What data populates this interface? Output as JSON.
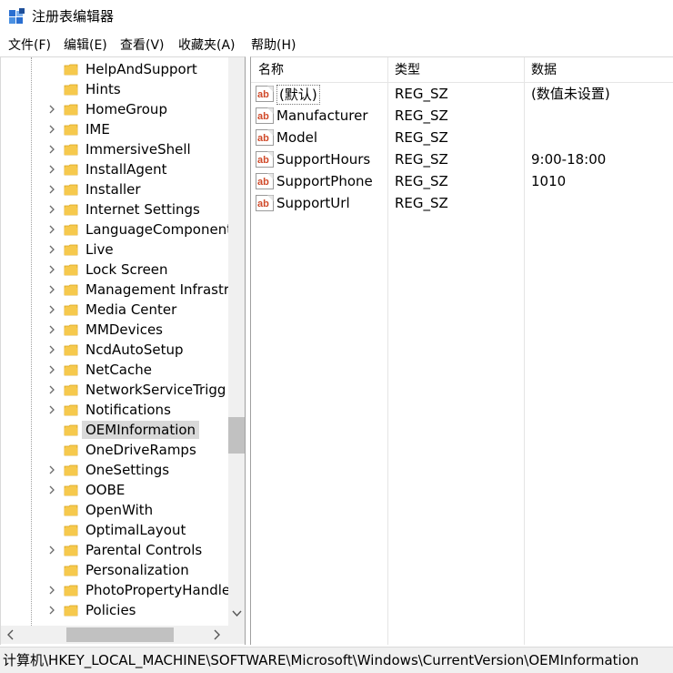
{
  "window": {
    "title": "注册表编辑器",
    "icon": "regedit-icon"
  },
  "menu": [
    "文件(F)",
    "编辑(E)",
    "查看(V)",
    "收藏夹(A)",
    "帮助(H)"
  ],
  "tree": {
    "items": [
      {
        "label": "HelpAndSupport",
        "expandable": false,
        "selected": false
      },
      {
        "label": "Hints",
        "expandable": false,
        "selected": false
      },
      {
        "label": "HomeGroup",
        "expandable": true,
        "selected": false
      },
      {
        "label": "IME",
        "expandable": true,
        "selected": false
      },
      {
        "label": "ImmersiveShell",
        "expandable": true,
        "selected": false
      },
      {
        "label": "InstallAgent",
        "expandable": true,
        "selected": false
      },
      {
        "label": "Installer",
        "expandable": true,
        "selected": false
      },
      {
        "label": "Internet Settings",
        "expandable": true,
        "selected": false
      },
      {
        "label": "LanguageComponent",
        "expandable": true,
        "selected": false
      },
      {
        "label": "Live",
        "expandable": true,
        "selected": false
      },
      {
        "label": "Lock Screen",
        "expandable": true,
        "selected": false
      },
      {
        "label": "Management Infrastru",
        "expandable": true,
        "selected": false
      },
      {
        "label": "Media Center",
        "expandable": true,
        "selected": false
      },
      {
        "label": "MMDevices",
        "expandable": true,
        "selected": false
      },
      {
        "label": "NcdAutoSetup",
        "expandable": true,
        "selected": false
      },
      {
        "label": "NetCache",
        "expandable": true,
        "selected": false
      },
      {
        "label": "NetworkServiceTrigg",
        "expandable": true,
        "selected": false
      },
      {
        "label": "Notifications",
        "expandable": true,
        "selected": false
      },
      {
        "label": "OEMInformation",
        "expandable": false,
        "selected": true
      },
      {
        "label": "OneDriveRamps",
        "expandable": false,
        "selected": false
      },
      {
        "label": "OneSettings",
        "expandable": true,
        "selected": false
      },
      {
        "label": "OOBE",
        "expandable": true,
        "selected": false
      },
      {
        "label": "OpenWith",
        "expandable": false,
        "selected": false
      },
      {
        "label": "OptimalLayout",
        "expandable": false,
        "selected": false
      },
      {
        "label": "Parental Controls",
        "expandable": true,
        "selected": false
      },
      {
        "label": "Personalization",
        "expandable": false,
        "selected": false
      },
      {
        "label": "PhotoPropertyHandle",
        "expandable": true,
        "selected": false
      },
      {
        "label": "Policies",
        "expandable": true,
        "selected": false
      }
    ],
    "scroll_position": 0.7
  },
  "list": {
    "headers": {
      "name": "名称",
      "type": "类型",
      "data": "数据"
    },
    "rows": [
      {
        "name": "(默认)",
        "type": "REG_SZ",
        "data": "(数值未设置)"
      },
      {
        "name": "Manufacturer",
        "type": "REG_SZ",
        "data": ""
      },
      {
        "name": "Model",
        "type": "REG_SZ",
        "data": ""
      },
      {
        "name": "SupportHours",
        "type": "REG_SZ",
        "data": "9:00-18:00"
      },
      {
        "name": "SupportPhone",
        "type": "REG_SZ",
        "data": "1010"
      },
      {
        "name": "SupportUrl",
        "type": "REG_SZ",
        "data": ""
      }
    ],
    "row_icon": "reg-string-ab-icon"
  },
  "status": {
    "path": "计算机\\HKEY_LOCAL_MACHINE\\SOFTWARE\\Microsoft\\Windows\\CurrentVersion\\OEMInformation"
  },
  "colors": {
    "folder": "#f6c94d",
    "folder_dark": "#d9a520",
    "selected_bg": "#d9d9d9",
    "ab_red": "#d04a2a"
  }
}
